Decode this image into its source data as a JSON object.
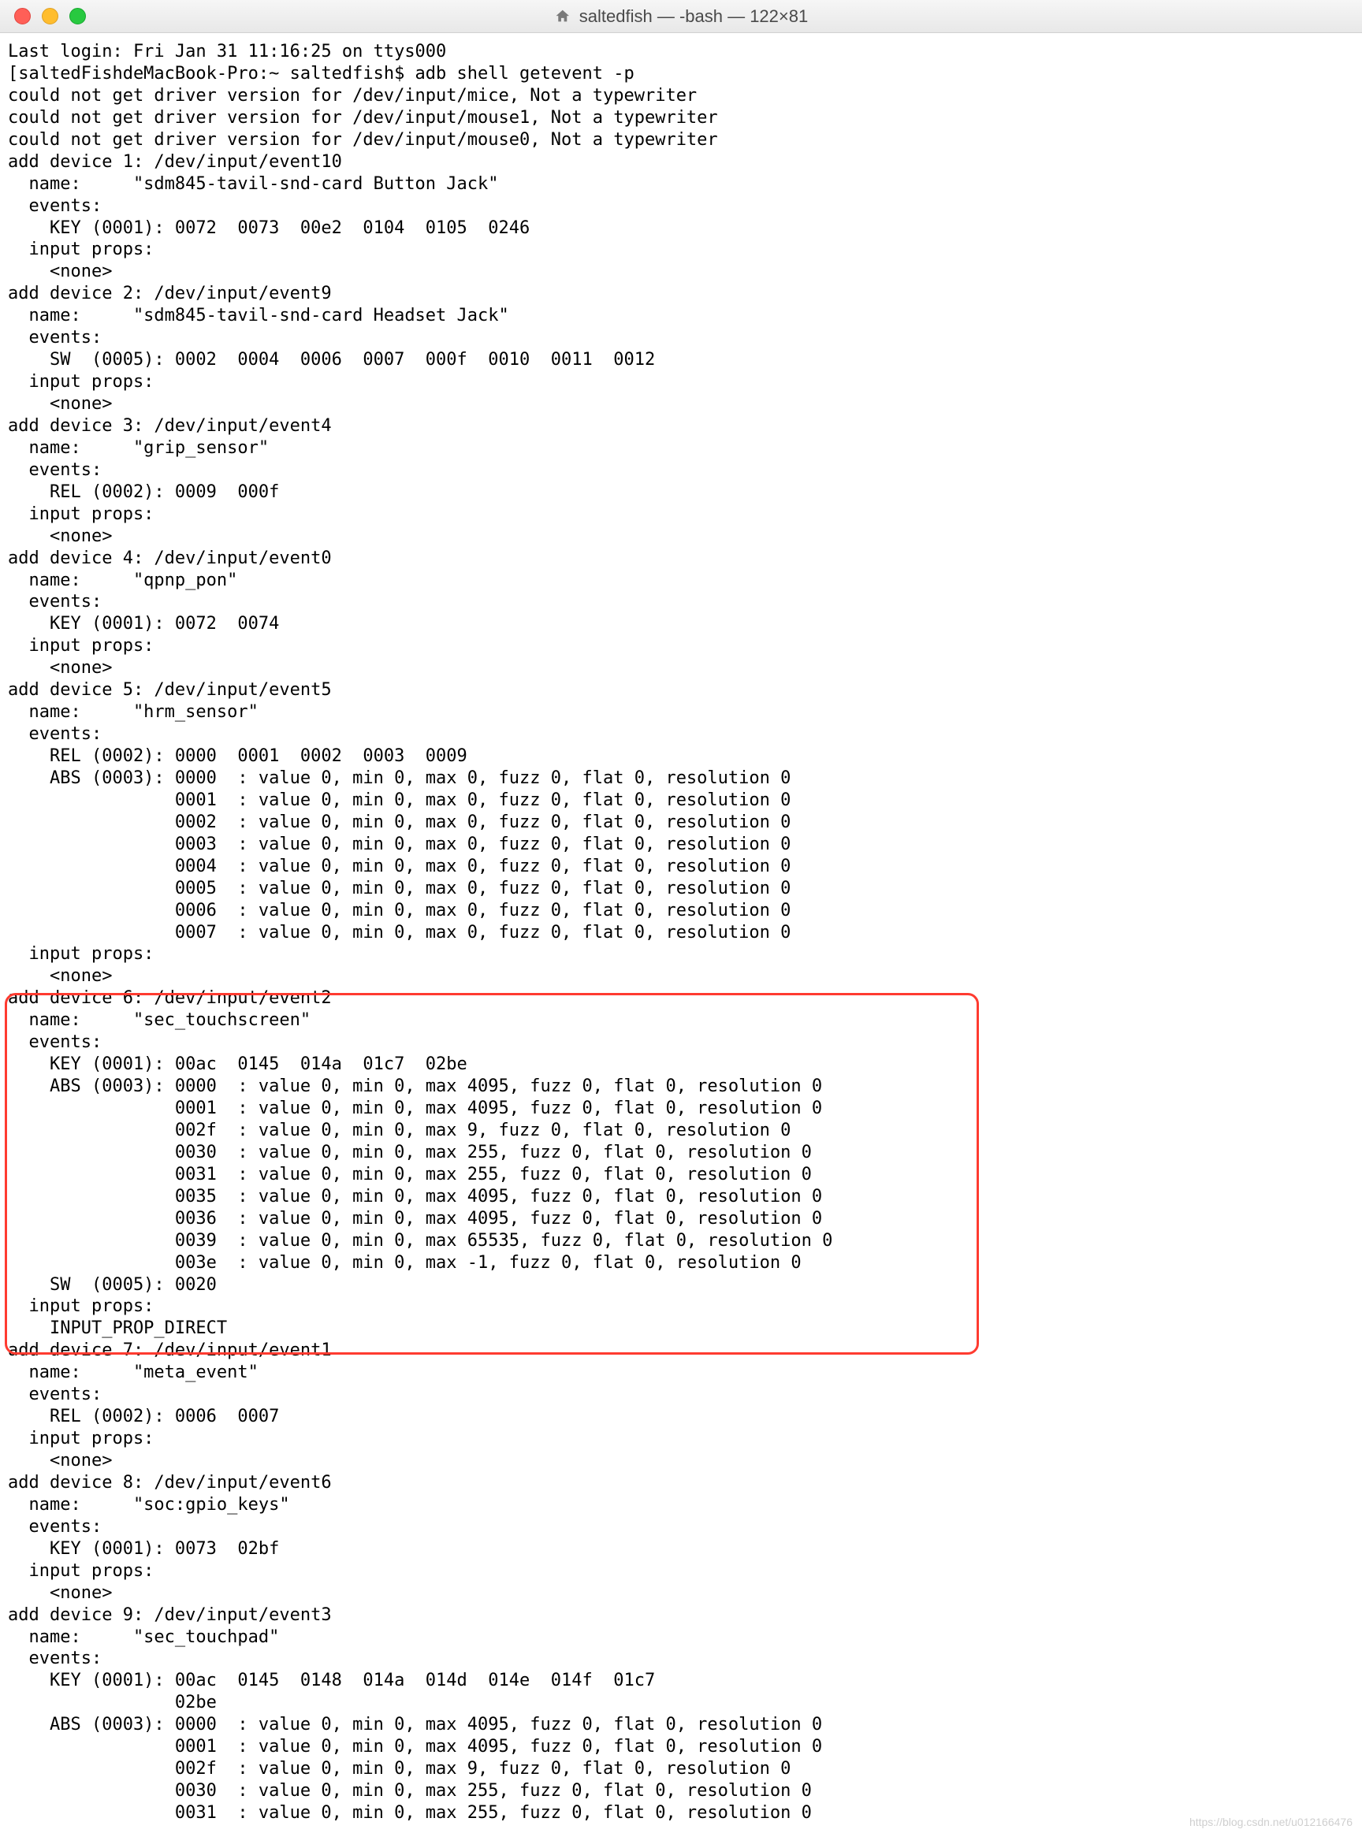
{
  "window": {
    "title": "saltedfish — -bash — 122×81"
  },
  "terminal": {
    "lines": [
      "Last login: Fri Jan 31 11:16:25 on ttys000",
      "[saltedFishdeMacBook-Pro:~ saltedfish$ adb shell getevent -p",
      "could not get driver version for /dev/input/mice, Not a typewriter",
      "could not get driver version for /dev/input/mouse1, Not a typewriter",
      "could not get driver version for /dev/input/mouse0, Not a typewriter",
      "add device 1: /dev/input/event10",
      "  name:     \"sdm845-tavil-snd-card Button Jack\"",
      "  events:",
      "    KEY (0001): 0072  0073  00e2  0104  0105  0246",
      "  input props:",
      "    <none>",
      "add device 2: /dev/input/event9",
      "  name:     \"sdm845-tavil-snd-card Headset Jack\"",
      "  events:",
      "    SW  (0005): 0002  0004  0006  0007  000f  0010  0011  0012",
      "  input props:",
      "    <none>",
      "add device 3: /dev/input/event4",
      "  name:     \"grip_sensor\"",
      "  events:",
      "    REL (0002): 0009  000f",
      "  input props:",
      "    <none>",
      "add device 4: /dev/input/event0",
      "  name:     \"qpnp_pon\"",
      "  events:",
      "    KEY (0001): 0072  0074",
      "  input props:",
      "    <none>",
      "add device 5: /dev/input/event5",
      "  name:     \"hrm_sensor\"",
      "  events:",
      "    REL (0002): 0000  0001  0002  0003  0009",
      "    ABS (0003): 0000  : value 0, min 0, max 0, fuzz 0, flat 0, resolution 0",
      "                0001  : value 0, min 0, max 0, fuzz 0, flat 0, resolution 0",
      "                0002  : value 0, min 0, max 0, fuzz 0, flat 0, resolution 0",
      "                0003  : value 0, min 0, max 0, fuzz 0, flat 0, resolution 0",
      "                0004  : value 0, min 0, max 0, fuzz 0, flat 0, resolution 0",
      "                0005  : value 0, min 0, max 0, fuzz 0, flat 0, resolution 0",
      "                0006  : value 0, min 0, max 0, fuzz 0, flat 0, resolution 0",
      "                0007  : value 0, min 0, max 0, fuzz 0, flat 0, resolution 0",
      "  input props:",
      "    <none>",
      "add device 6: /dev/input/event2",
      "  name:     \"sec_touchscreen\"",
      "  events:",
      "    KEY (0001): 00ac  0145  014a  01c7  02be",
      "    ABS (0003): 0000  : value 0, min 0, max 4095, fuzz 0, flat 0, resolution 0",
      "                0001  : value 0, min 0, max 4095, fuzz 0, flat 0, resolution 0",
      "                002f  : value 0, min 0, max 9, fuzz 0, flat 0, resolution 0",
      "                0030  : value 0, min 0, max 255, fuzz 0, flat 0, resolution 0",
      "                0031  : value 0, min 0, max 255, fuzz 0, flat 0, resolution 0",
      "                0035  : value 0, min 0, max 4095, fuzz 0, flat 0, resolution 0",
      "                0036  : value 0, min 0, max 4095, fuzz 0, flat 0, resolution 0",
      "                0039  : value 0, min 0, max 65535, fuzz 0, flat 0, resolution 0",
      "                003e  : value 0, min 0, max -1, fuzz 0, flat 0, resolution 0",
      "    SW  (0005): 0020",
      "  input props:",
      "    INPUT_PROP_DIRECT",
      "add device 7: /dev/input/event1",
      "  name:     \"meta_event\"",
      "  events:",
      "    REL (0002): 0006  0007",
      "  input props:",
      "    <none>",
      "add device 8: /dev/input/event6",
      "  name:     \"soc:gpio_keys\"",
      "  events:",
      "    KEY (0001): 0073  02bf",
      "  input props:",
      "    <none>",
      "add device 9: /dev/input/event3",
      "  name:     \"sec_touchpad\"",
      "  events:",
      "    KEY (0001): 00ac  0145  0148  014a  014d  014e  014f  01c7",
      "                02be",
      "    ABS (0003): 0000  : value 0, min 0, max 4095, fuzz 0, flat 0, resolution 0",
      "                0001  : value 0, min 0, max 4095, fuzz 0, flat 0, resolution 0",
      "                002f  : value 0, min 0, max 9, fuzz 0, flat 0, resolution 0",
      "                0030  : value 0, min 0, max 255, fuzz 0, flat 0, resolution 0",
      "                0031  : value 0, min 0, max 255, fuzz 0, flat 0, resolution 0"
    ]
  },
  "watermark": "https://blog.csdn.net/u012166476"
}
